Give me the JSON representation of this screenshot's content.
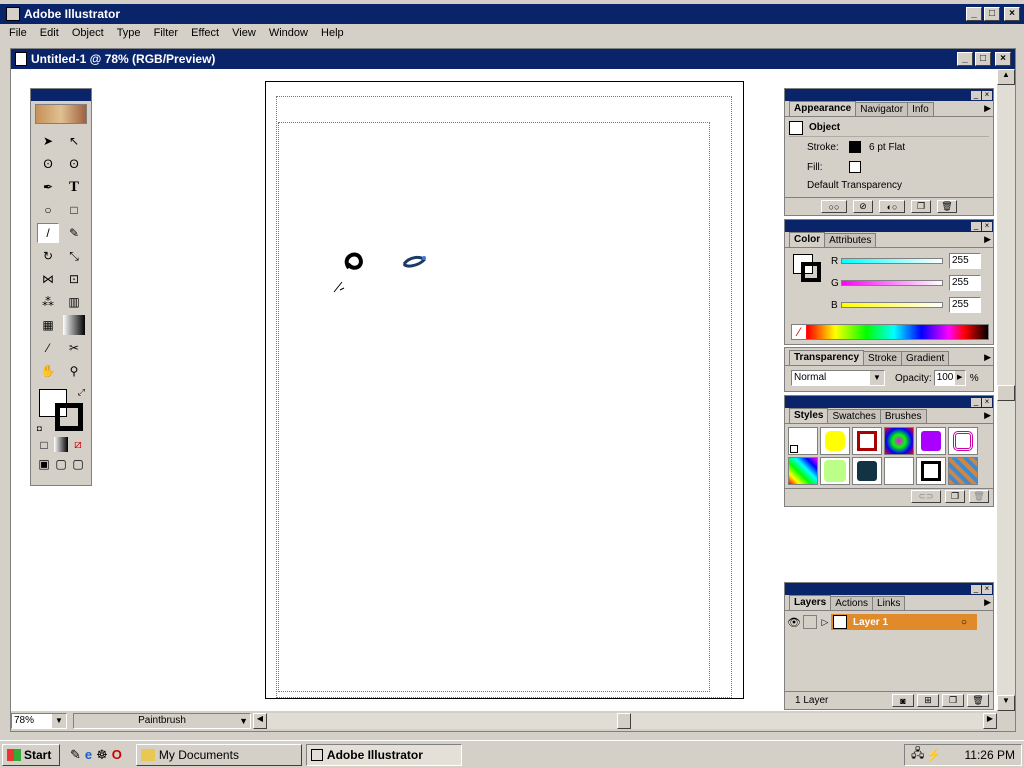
{
  "app": {
    "title": "Adobe Illustrator"
  },
  "menu": [
    "File",
    "Edit",
    "Object",
    "Type",
    "Filter",
    "Effect",
    "View",
    "Window",
    "Help"
  ],
  "document": {
    "title": "Untitled-1 @ 78% (RGB/Preview)"
  },
  "status": {
    "zoom": "78%",
    "tool": "Paintbrush"
  },
  "appearance_panel": {
    "tabs": [
      "Appearance",
      "Navigator",
      "Info"
    ],
    "object_label": "Object",
    "stroke_label": "Stroke:",
    "stroke_value": "6 pt Flat",
    "fill_label": "Fill:",
    "transparency": "Default Transparency"
  },
  "color_panel": {
    "tabs": [
      "Color",
      "Attributes"
    ],
    "r_label": "R",
    "r_value": "255",
    "g_label": "G",
    "g_value": "255",
    "b_label": "B",
    "b_value": "255"
  },
  "transparency_panel": {
    "tabs": [
      "Transparency",
      "Stroke",
      "Gradient"
    ],
    "mode": "Normal",
    "opacity_label": "Opacity:",
    "opacity_value": "100",
    "opacity_unit": "%"
  },
  "styles_panel": {
    "tabs": [
      "Styles",
      "Swatches",
      "Brushes"
    ]
  },
  "layers_panel": {
    "tabs": [
      "Layers",
      "Actions",
      "Links"
    ],
    "layer_name": "Layer 1",
    "footer": "1 Layer"
  },
  "taskbar": {
    "start": "Start",
    "tasks": [
      "My Documents",
      "Adobe Illustrator"
    ],
    "clock": "11:26 PM"
  },
  "colors": {
    "title_bar": "#0a246a",
    "face": "#d4d0c8",
    "layer_highlight": "#e08a2a"
  }
}
